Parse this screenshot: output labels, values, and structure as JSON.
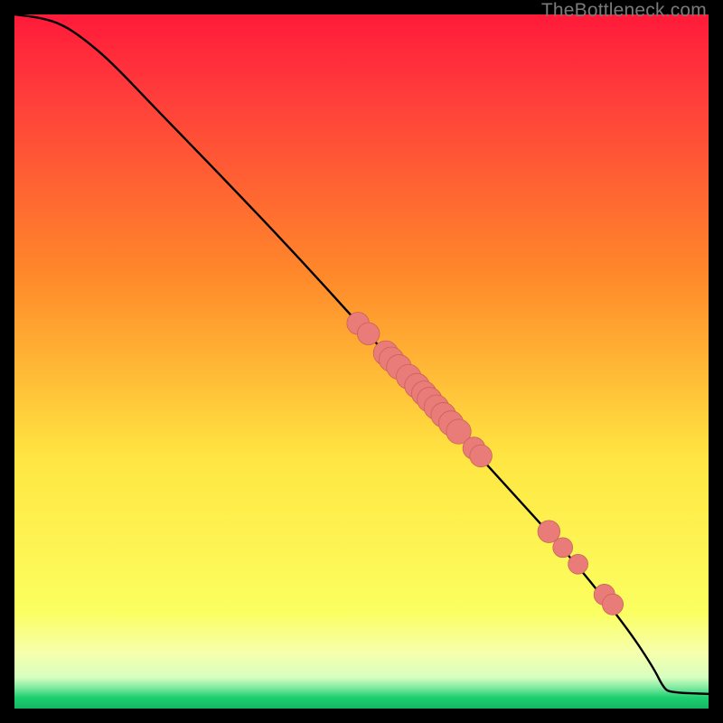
{
  "attribution": "TheBottleneck.com",
  "colors": {
    "frame": "#000000",
    "curve": "#000000",
    "markers": "#e97c78",
    "marker_stroke": "#c96258",
    "gradient_top": "#ff1a3a",
    "gradient_mid1": "#ff8a2a",
    "gradient_mid2": "#ffe642",
    "gradient_band": "#f6ffad",
    "gradient_green": "#1dd070"
  },
  "chart_data": {
    "type": "line",
    "title": "",
    "xlabel": "",
    "ylabel": "",
    "xlim": [
      0,
      100
    ],
    "ylim": [
      0,
      100
    ],
    "curve": [
      {
        "x": 0,
        "y": 100
      },
      {
        "x": 4,
        "y": 99.5
      },
      {
        "x": 7,
        "y": 98.5
      },
      {
        "x": 10,
        "y": 96.5
      },
      {
        "x": 14,
        "y": 93.1
      },
      {
        "x": 20,
        "y": 86.8
      },
      {
        "x": 30,
        "y": 76.5
      },
      {
        "x": 40,
        "y": 66.0
      },
      {
        "x": 50,
        "y": 55.0
      },
      {
        "x": 60,
        "y": 44.0
      },
      {
        "x": 70,
        "y": 33.0
      },
      {
        "x": 80,
        "y": 22.0
      },
      {
        "x": 88,
        "y": 12.0
      },
      {
        "x": 92,
        "y": 6.0
      },
      {
        "x": 93.5,
        "y": 3.0
      },
      {
        "x": 94.5,
        "y": 2.3
      },
      {
        "x": 100,
        "y": 2.1
      }
    ],
    "markers": [
      {
        "x": 49.5,
        "y": 55.5,
        "r": 1.2
      },
      {
        "x": 51.0,
        "y": 54.0,
        "r": 1.2
      },
      {
        "x": 53.5,
        "y": 51.2,
        "r": 1.4
      },
      {
        "x": 54.3,
        "y": 50.3,
        "r": 1.4
      },
      {
        "x": 55.4,
        "y": 49.2,
        "r": 1.4
      },
      {
        "x": 56.8,
        "y": 47.8,
        "r": 1.4
      },
      {
        "x": 58.0,
        "y": 46.5,
        "r": 1.4
      },
      {
        "x": 59.0,
        "y": 45.4,
        "r": 1.4
      },
      {
        "x": 59.8,
        "y": 44.5,
        "r": 1.4
      },
      {
        "x": 60.8,
        "y": 43.4,
        "r": 1.4
      },
      {
        "x": 61.8,
        "y": 42.3,
        "r": 1.4
      },
      {
        "x": 62.9,
        "y": 41.1,
        "r": 1.4
      },
      {
        "x": 64.0,
        "y": 39.9,
        "r": 1.4
      },
      {
        "x": 66.2,
        "y": 37.5,
        "r": 1.2
      },
      {
        "x": 67.2,
        "y": 36.4,
        "r": 1.2
      },
      {
        "x": 77.0,
        "y": 25.5,
        "r": 1.2
      },
      {
        "x": 79.0,
        "y": 23.2,
        "r": 1.0
      },
      {
        "x": 81.2,
        "y": 20.8,
        "r": 1.0
      },
      {
        "x": 85.0,
        "y": 16.4,
        "r": 1.1
      },
      {
        "x": 86.2,
        "y": 15.0,
        "r": 1.1
      }
    ]
  }
}
